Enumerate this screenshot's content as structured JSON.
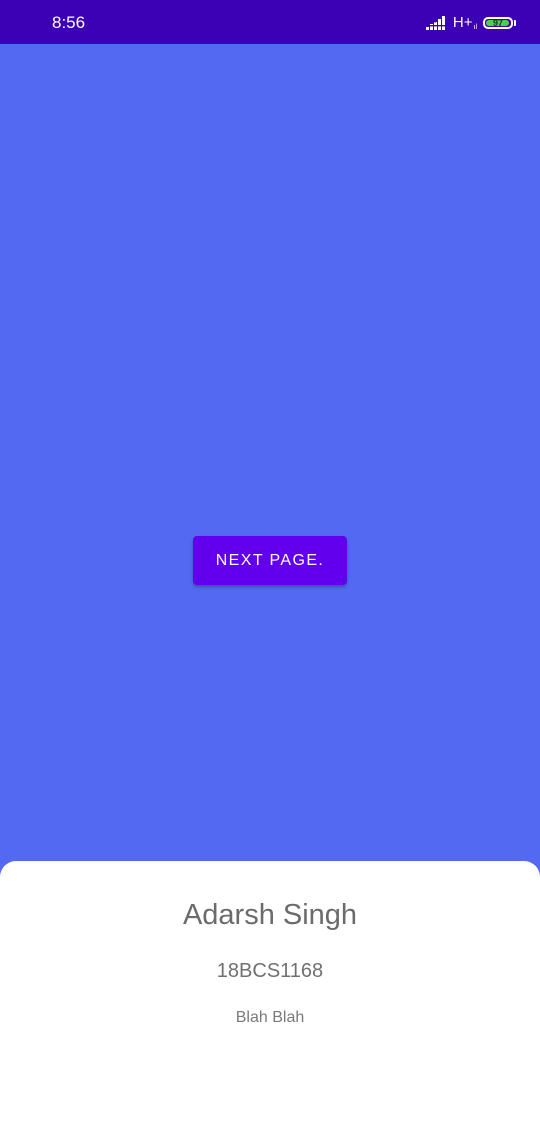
{
  "status_bar": {
    "time": "8:56",
    "network": "H+",
    "network_sub": "ıl",
    "battery_level": "97",
    "battery_percent": 97,
    "icons": [
      "signal-icon",
      "battery-icon"
    ],
    "background": "#3D01B5"
  },
  "main": {
    "background": "#5369F2",
    "button_label": "NEXT PAGE.",
    "button_color": "#6200EE"
  },
  "profile": {
    "name": "Adarsh Singh",
    "id": "18BCS1168",
    "description": "Blah Blah"
  }
}
